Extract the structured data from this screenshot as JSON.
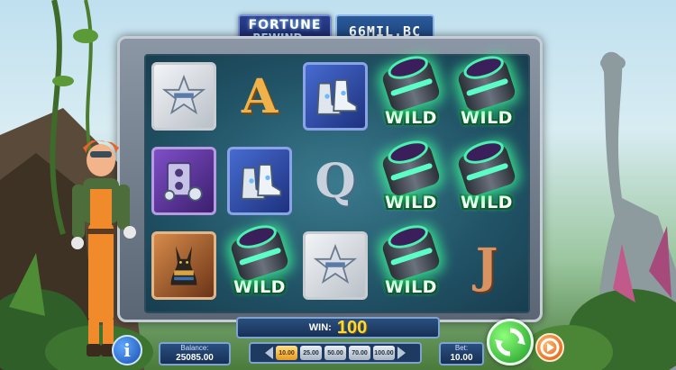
{
  "game": {
    "logo_line1": "FORTUNE",
    "logo_line2": "REWIND ◂◂",
    "era": "66MIL.BC"
  },
  "reels": [
    [
      {
        "symbol": "sheriff-badge",
        "style": "silver"
      },
      {
        "symbol": "tape-recorder",
        "style": "purple"
      },
      {
        "symbol": "anubis",
        "style": "gold"
      }
    ],
    [
      {
        "symbol": "letter",
        "letter": "A",
        "cls": "a"
      },
      {
        "symbol": "rocket-boots",
        "style": "blue"
      },
      {
        "symbol": "wild",
        "text": "WILD"
      }
    ],
    [
      {
        "symbol": "rocket-boots",
        "style": "blue"
      },
      {
        "symbol": "letter",
        "letter": "Q",
        "cls": "q"
      },
      {
        "symbol": "sheriff-badge",
        "style": "silver"
      }
    ],
    [
      {
        "symbol": "wild",
        "text": "WILD"
      },
      {
        "symbol": "wild",
        "text": "WILD"
      },
      {
        "symbol": "wild",
        "text": "WILD"
      }
    ],
    [
      {
        "symbol": "wild",
        "text": "WILD"
      },
      {
        "symbol": "wild",
        "text": "WILD"
      },
      {
        "symbol": "letter",
        "letter": "J",
        "cls": "j"
      }
    ]
  ],
  "win": {
    "label": "WIN:",
    "value": "100"
  },
  "balance": {
    "label": "Balance:",
    "value": "25085.00"
  },
  "bet": {
    "label": "Bet:",
    "value": "10.00",
    "options": [
      "10.00",
      "25.00",
      "50.00",
      "70.00",
      "100.00"
    ],
    "selected_index": 0
  },
  "buttons": {
    "info": "i"
  }
}
